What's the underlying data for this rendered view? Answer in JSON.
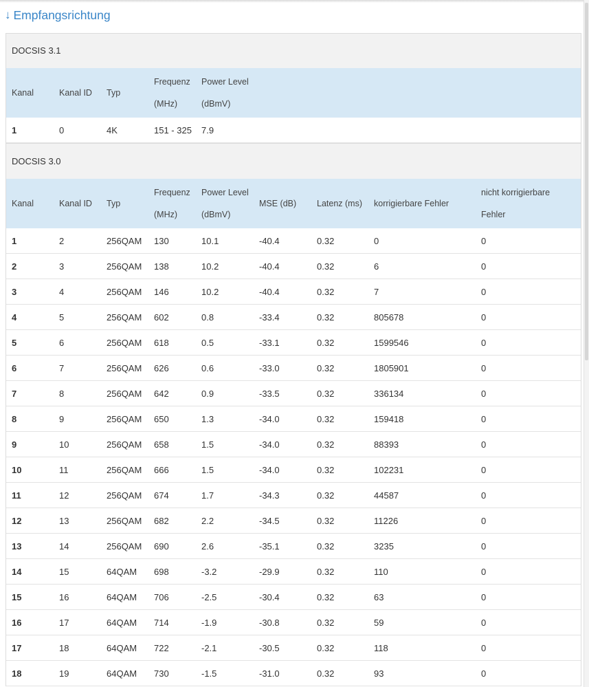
{
  "heading": {
    "arrow": "↓",
    "title": "Empfangsrichtung"
  },
  "docsis31": {
    "title": "DOCSIS 3.1",
    "headers": [
      [
        "Kanal",
        ""
      ],
      [
        "Kanal ID",
        ""
      ],
      [
        "Typ",
        ""
      ],
      [
        "Frequenz",
        "(MHz)"
      ],
      [
        "Power Level",
        "(dBmV)"
      ]
    ],
    "rows": [
      [
        "1",
        "0",
        "4K",
        "151 - 325",
        "7.9"
      ]
    ]
  },
  "docsis30": {
    "title": "DOCSIS 3.0",
    "headers": [
      [
        "Kanal",
        ""
      ],
      [
        "Kanal ID",
        ""
      ],
      [
        "Typ",
        ""
      ],
      [
        "Frequenz",
        "(MHz)"
      ],
      [
        "Power Level",
        "(dBmV)"
      ],
      [
        "MSE (dB)",
        ""
      ],
      [
        "Latenz (ms)",
        ""
      ],
      [
        "korrigierbare Fehler",
        ""
      ],
      [
        "nicht korrigierbare",
        "Fehler"
      ]
    ],
    "rows": [
      [
        "1",
        "2",
        "256QAM",
        "130",
        "10.1",
        "-40.4",
        "0.32",
        "0",
        "0"
      ],
      [
        "2",
        "3",
        "256QAM",
        "138",
        "10.2",
        "-40.4",
        "0.32",
        "6",
        "0"
      ],
      [
        "3",
        "4",
        "256QAM",
        "146",
        "10.2",
        "-40.4",
        "0.32",
        "7",
        "0"
      ],
      [
        "4",
        "5",
        "256QAM",
        "602",
        "0.8",
        "-33.4",
        "0.32",
        "805678",
        "0"
      ],
      [
        "5",
        "6",
        "256QAM",
        "618",
        "0.5",
        "-33.1",
        "0.32",
        "1599546",
        "0"
      ],
      [
        "6",
        "7",
        "256QAM",
        "626",
        "0.6",
        "-33.0",
        "0.32",
        "1805901",
        "0"
      ],
      [
        "7",
        "8",
        "256QAM",
        "642",
        "0.9",
        "-33.5",
        "0.32",
        "336134",
        "0"
      ],
      [
        "8",
        "9",
        "256QAM",
        "650",
        "1.3",
        "-34.0",
        "0.32",
        "159418",
        "0"
      ],
      [
        "9",
        "10",
        "256QAM",
        "658",
        "1.5",
        "-34.0",
        "0.32",
        "88393",
        "0"
      ],
      [
        "10",
        "11",
        "256QAM",
        "666",
        "1.5",
        "-34.0",
        "0.32",
        "102231",
        "0"
      ],
      [
        "11",
        "12",
        "256QAM",
        "674",
        "1.7",
        "-34.3",
        "0.32",
        "44587",
        "0"
      ],
      [
        "12",
        "13",
        "256QAM",
        "682",
        "2.2",
        "-34.5",
        "0.32",
        "11226",
        "0"
      ],
      [
        "13",
        "14",
        "256QAM",
        "690",
        "2.6",
        "-35.1",
        "0.32",
        "3235",
        "0"
      ],
      [
        "14",
        "15",
        "64QAM",
        "698",
        "-3.2",
        "-29.9",
        "0.32",
        "110",
        "0"
      ],
      [
        "15",
        "16",
        "64QAM",
        "706",
        "-2.5",
        "-30.4",
        "0.32",
        "63",
        "0"
      ],
      [
        "16",
        "17",
        "64QAM",
        "714",
        "-1.9",
        "-30.8",
        "0.32",
        "59",
        "0"
      ],
      [
        "17",
        "18",
        "64QAM",
        "722",
        "-2.1",
        "-30.5",
        "0.32",
        "118",
        "0"
      ],
      [
        "18",
        "19",
        "64QAM",
        "730",
        "-1.5",
        "-31.0",
        "0.32",
        "93",
        "0"
      ]
    ]
  }
}
